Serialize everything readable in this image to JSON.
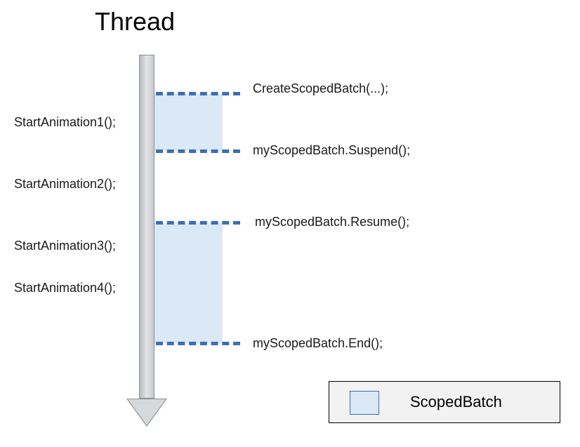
{
  "title": "Thread",
  "left_labels": [
    "StartAnimation1();",
    "StartAnimation2();",
    "StartAnimation3();",
    "StartAnimation4();"
  ],
  "right_labels": [
    "CreateScopedBatch(...);",
    "myScopedBatch.Suspend();",
    "myScopedBatch.Resume();",
    "myScopedBatch.End();"
  ],
  "legend": {
    "label": "ScopedBatch"
  },
  "chart_data": {
    "type": "diagram",
    "title": "Thread",
    "description": "Timeline showing animations started on a thread and which ones fall inside an active ScopedBatch.",
    "thread_events_in_order": [
      {
        "event": "CreateScopedBatch(...);",
        "side": "right",
        "batch_active_after": true
      },
      {
        "event": "StartAnimation1();",
        "side": "left",
        "inside_batch": true
      },
      {
        "event": "myScopedBatch.Suspend();",
        "side": "right",
        "batch_active_after": false
      },
      {
        "event": "StartAnimation2();",
        "side": "left",
        "inside_batch": false
      },
      {
        "event": "myScopedBatch.Resume();",
        "side": "right",
        "batch_active_after": true
      },
      {
        "event": "StartAnimation3();",
        "side": "left",
        "inside_batch": true
      },
      {
        "event": "StartAnimation4();",
        "side": "left",
        "inside_batch": true
      },
      {
        "event": "myScopedBatch.End();",
        "side": "right",
        "batch_active_after": false
      }
    ],
    "batch_active_regions": [
      {
        "from": "CreateScopedBatch(...);",
        "to": "myScopedBatch.Suspend();"
      },
      {
        "from": "myScopedBatch.Resume();",
        "to": "myScopedBatch.End();"
      }
    ],
    "legend": {
      "swatch": "light-blue",
      "label": "ScopedBatch"
    }
  }
}
